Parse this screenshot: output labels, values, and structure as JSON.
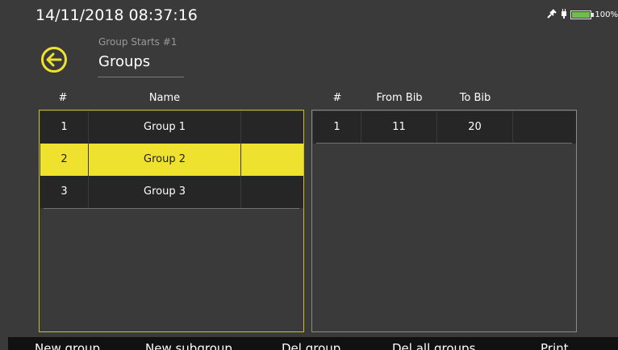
{
  "header": {
    "datetime": "14/11/2018  08:37:16",
    "battery_text": "100%",
    "subtitle": "Group Starts #1",
    "title": "Groups"
  },
  "colors": {
    "accent": "#efe22e",
    "background": "#3a3a3a",
    "row": "#262626",
    "battery": "#6cc04a"
  },
  "groups_table": {
    "columns": [
      "#",
      "Name"
    ],
    "rows": [
      {
        "num": "1",
        "name": "Group 1"
      },
      {
        "num": "2",
        "name": "Group 2"
      },
      {
        "num": "3",
        "name": "Group 3"
      }
    ],
    "selected_row": 2
  },
  "subgroups_table": {
    "columns": [
      "#",
      "From Bib",
      "To Bib"
    ],
    "rows": [
      {
        "num": "1",
        "from": "11",
        "to": "20"
      }
    ]
  },
  "toolbar": {
    "new_group": "New group",
    "new_subgroup": "New subgroup",
    "del_group": "Del group",
    "del_all_groups": "Del all groups",
    "print": "Print"
  },
  "icons": {
    "back": "back-arrow-circle-icon",
    "gps": "satellite-icon",
    "plug": "plug-icon",
    "battery": "battery-icon"
  }
}
